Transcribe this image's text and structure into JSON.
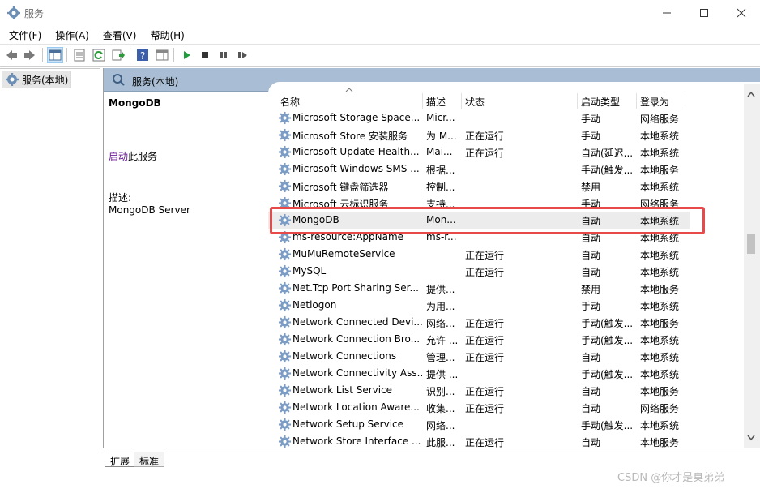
{
  "window": {
    "title": "服务"
  },
  "menu": [
    "文件(F)",
    "操作(A)",
    "查看(V)",
    "帮助(H)"
  ],
  "tree": {
    "root": "服务(本地)"
  },
  "pane": {
    "header": "服务(本地)"
  },
  "details": {
    "service_name": "MongoDB",
    "start_link": "启动",
    "start_suffix": "此服务",
    "desc_label": "描述:",
    "desc_text": "MongoDB Server"
  },
  "columns": [
    "名称",
    "描述",
    "状态",
    "启动类型",
    "登录为"
  ],
  "rows": [
    [
      "Microsoft Storage Space...",
      "Micr...",
      "",
      "手动",
      "网络服务"
    ],
    [
      "Microsoft Store 安装服务",
      "为 M...",
      "正在运行",
      "手动",
      "本地系统"
    ],
    [
      "Microsoft Update Health...",
      "Mai...",
      "正在运行",
      "自动(延迟...",
      "本地系统"
    ],
    [
      "Microsoft Windows SMS ...",
      "根据...",
      "",
      "手动(触发...",
      "本地服务"
    ],
    [
      "Microsoft 键盘筛选器",
      "控制...",
      "",
      "禁用",
      "本地系统"
    ],
    [
      "Microsoft 云标识服务",
      "支持...",
      "",
      "手动",
      "网络服务"
    ],
    [
      "MongoDB",
      "Mon...",
      "",
      "自动",
      "本地系统"
    ],
    [
      "ms-resource:AppName",
      "ms-r...",
      "",
      "自动",
      "本地系统"
    ],
    [
      "MuMuRemoteService",
      "",
      "正在运行",
      "自动",
      "本地系统"
    ],
    [
      "MySQL",
      "",
      "正在运行",
      "自动",
      "本地系统"
    ],
    [
      "Net.Tcp Port Sharing Ser...",
      "提供...",
      "",
      "禁用",
      "本地服务"
    ],
    [
      "Netlogon",
      "为用...",
      "",
      "手动",
      "本地系统"
    ],
    [
      "Network Connected Devi...",
      "网络...",
      "正在运行",
      "手动(触发...",
      "本地服务"
    ],
    [
      "Network Connection Bro...",
      "允许 ...",
      "正在运行",
      "手动(触发...",
      "本地系统"
    ],
    [
      "Network Connections",
      "管理...",
      "正在运行",
      "自动",
      "本地系统"
    ],
    [
      "Network Connectivity Ass...",
      "提供 ...",
      "",
      "手动(触发...",
      "本地系统"
    ],
    [
      "Network List Service",
      "识别...",
      "正在运行",
      "自动",
      "本地服务"
    ],
    [
      "Network Location Aware...",
      "收集...",
      "正在运行",
      "自动",
      "网络服务"
    ],
    [
      "Network Setup Service",
      "网络...",
      "",
      "手动(触发...",
      "本地系统"
    ],
    [
      "Network Store Interface ...",
      "此服...",
      "正在运行",
      "自动",
      "本地服务"
    ]
  ],
  "selected_row": "MongoDB",
  "tabs": [
    "扩展",
    "标准"
  ],
  "watermark": "CSDN @你才是臭弟弟",
  "colors": {
    "header_bg": "#a9bed4",
    "highlight": "#e84a4a",
    "link": "#6f1f9a",
    "play_green": "#1e9e3a"
  }
}
